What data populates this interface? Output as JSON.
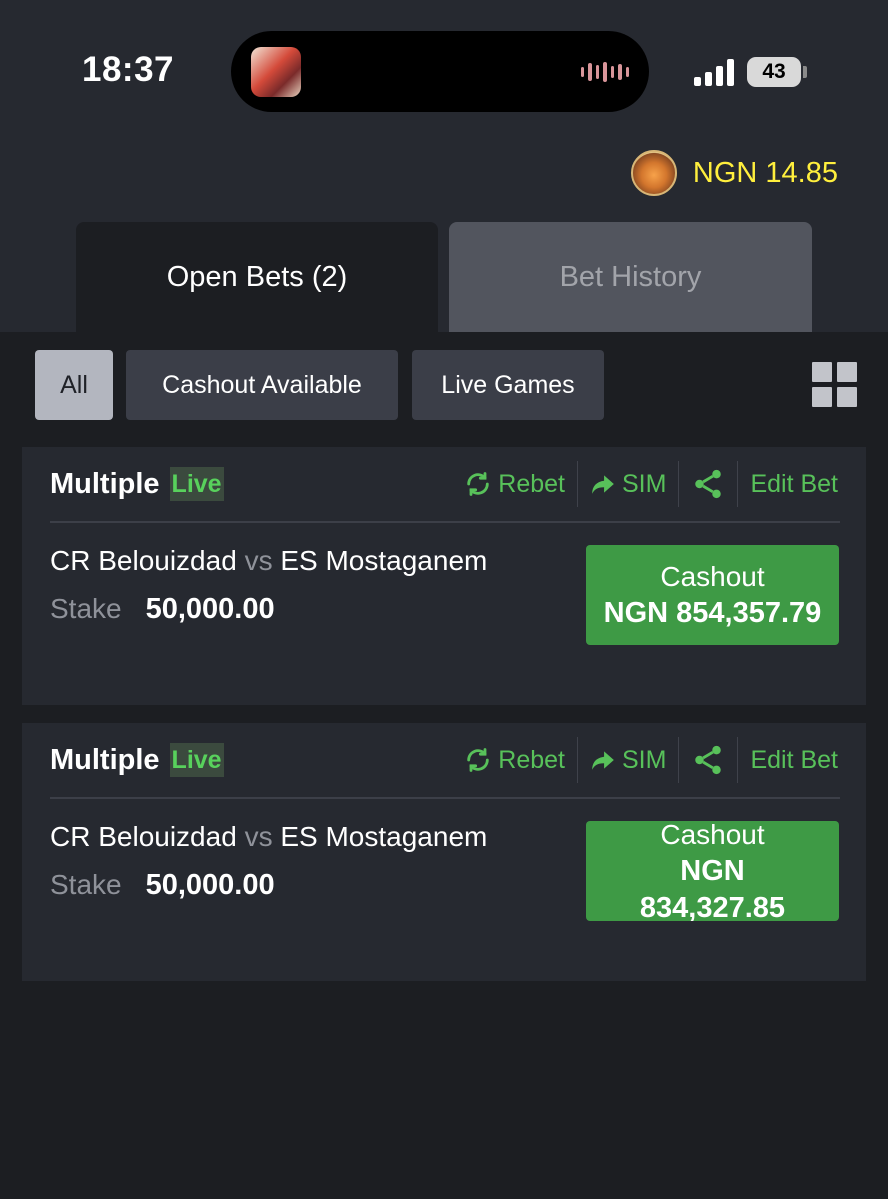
{
  "status_bar": {
    "time": "18:37",
    "battery": "43"
  },
  "balance": {
    "text": "NGN 14.85"
  },
  "tabs": [
    {
      "label": "Open Bets (2)",
      "active": true
    },
    {
      "label": "Bet History",
      "active": false
    }
  ],
  "filters": [
    {
      "label": "All",
      "selected": true
    },
    {
      "label": "Cashout Available",
      "selected": false
    },
    {
      "label": "Live Games",
      "selected": false
    }
  ],
  "actions": {
    "rebet": "Rebet",
    "sim": "SIM",
    "edit": "Edit Bet"
  },
  "bets": [
    {
      "title": "Multiple",
      "badge": "Live",
      "home": "CR Belouizdad",
      "vs": "vs",
      "away": "ES Mostaganem",
      "stake_label": "Stake",
      "stake": "50,000.00",
      "cashout_label": "Cashout",
      "cashout_amount": "NGN 854,357.79"
    },
    {
      "title": "Multiple",
      "badge": "Live",
      "home": "CR Belouizdad",
      "vs": "vs",
      "away": "ES Mostaganem",
      "stake_label": "Stake",
      "stake": "50,000.00",
      "cashout_label": "Cashout",
      "cashout_amount": "NGN 834,327.85"
    }
  ],
  "colors": {
    "accent_green": "#58c15a",
    "cashout_bg": "#3e9a45",
    "balance_yellow": "#ffef3d",
    "page_bg": "#1c1e22",
    "card_bg": "#262930"
  }
}
